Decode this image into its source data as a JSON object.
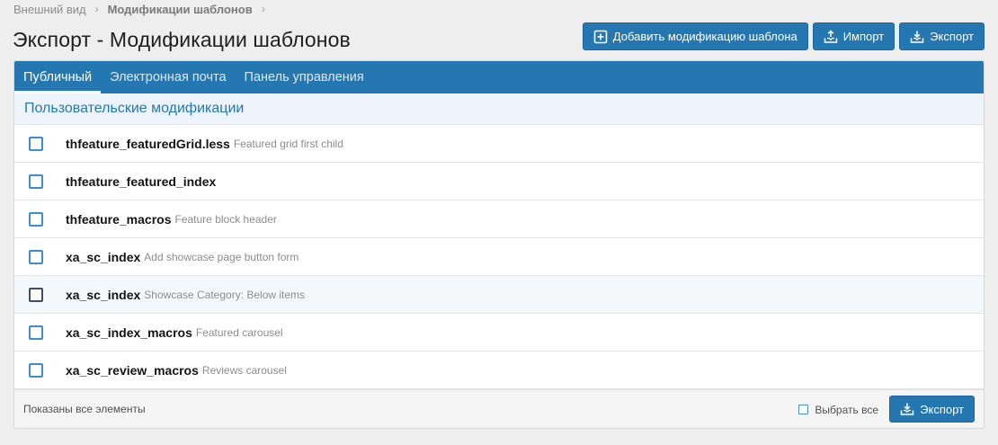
{
  "breadcrumb": {
    "items": [
      "Внешний вид",
      "Модификации шаблонов"
    ]
  },
  "page": {
    "title": "Экспорт - Модификации шаблонов"
  },
  "actions": {
    "add_label": "Добавить модификацию шаблона",
    "import_label": "Импорт",
    "export_label": "Экспорт",
    "add_icon": "plus-square-icon",
    "import_icon": "upload-tray-icon",
    "export_icon": "download-tray-icon"
  },
  "tabs": [
    {
      "label": "Публичный",
      "active": true
    },
    {
      "label": "Электронная почта",
      "active": false
    },
    {
      "label": "Панель управления",
      "active": false
    }
  ],
  "section": {
    "title": "Пользовательские модификации"
  },
  "rows": [
    {
      "name": "thfeature_featuredGrid.less",
      "hint": "Featured grid first child",
      "checked": false
    },
    {
      "name": "thfeature_featured_index",
      "hint": "",
      "checked": false
    },
    {
      "name": "thfeature_macros",
      "hint": "Feature block header",
      "checked": false
    },
    {
      "name": "xa_sc_index",
      "hint": "Add showcase page button form",
      "checked": false
    },
    {
      "name": "xa_sc_index",
      "hint": "Showcase Category: Below items",
      "checked": false
    },
    {
      "name": "xa_sc_index_macros",
      "hint": "Featured carousel",
      "checked": false
    },
    {
      "name": "xa_sc_review_macros",
      "hint": "Reviews carousel",
      "checked": false
    }
  ],
  "footer": {
    "status": "Показаны все элементы",
    "select_all_label": "Выбрать все",
    "export_label": "Экспорт"
  },
  "colors": {
    "accent": "#2577b1",
    "section_bg": "#edf4fb",
    "page_bg": "#eeeeee"
  }
}
